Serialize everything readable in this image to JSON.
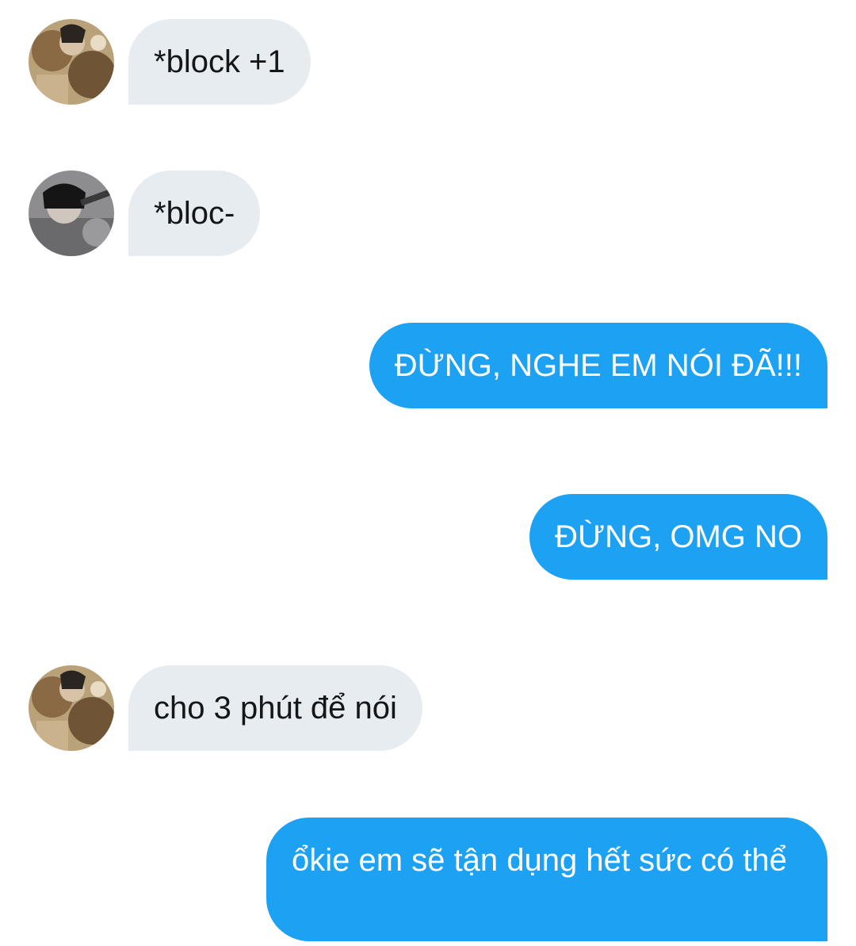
{
  "colors": {
    "received_bubble": "#e6ecf0",
    "sent_bubble": "#1da1f2",
    "received_text": "#14171a",
    "sent_text": "#ffffff"
  },
  "messages": [
    {
      "direction": "received",
      "avatar": "user-a-avatar",
      "text": "*block +1"
    },
    {
      "direction": "received",
      "avatar": "user-b-avatar",
      "text": "*bloc-"
    },
    {
      "direction": "sent",
      "text": "ĐỪNG, NGHE EM NÓI ĐÃ!!!"
    },
    {
      "direction": "sent",
      "text": "ĐỪNG, OMG NO"
    },
    {
      "direction": "received",
      "avatar": "user-a-avatar",
      "text": "cho 3 phút để nói"
    },
    {
      "direction": "sent",
      "text": "ổkie em sẽ tận dụng hết sức có thể"
    }
  ]
}
